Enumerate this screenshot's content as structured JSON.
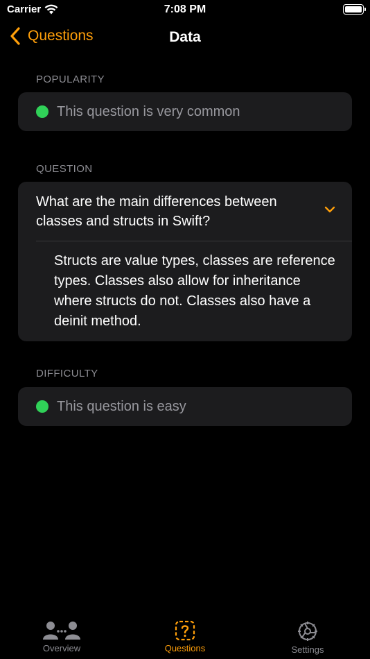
{
  "status_bar": {
    "carrier": "Carrier",
    "time": "7:08 PM"
  },
  "nav": {
    "back_label": "Questions",
    "title": "Data"
  },
  "popularity": {
    "header": "POPULARITY",
    "text": "This question is very common",
    "dot_color": "#30d158"
  },
  "question": {
    "header": "QUESTION",
    "text": "What are the main differences between classes and structs in Swift?",
    "answer": "Structs are value types, classes are reference types. Classes also allow for inheritance where structs do not. Classes also have a deinit method."
  },
  "difficulty": {
    "header": "DIFFICULTY",
    "text": "This question is easy",
    "dot_color": "#30d158"
  },
  "tabs": [
    {
      "label": "Overview",
      "icon": "people-icon"
    },
    {
      "label": "Questions",
      "icon": "question-square-icon",
      "active": true
    },
    {
      "label": "Settings",
      "icon": "gear-icon"
    }
  ],
  "colors": {
    "accent": "#ff9f0a",
    "card": "#1c1c1e",
    "background": "#000000",
    "secondary_text": "#8d8d93"
  }
}
